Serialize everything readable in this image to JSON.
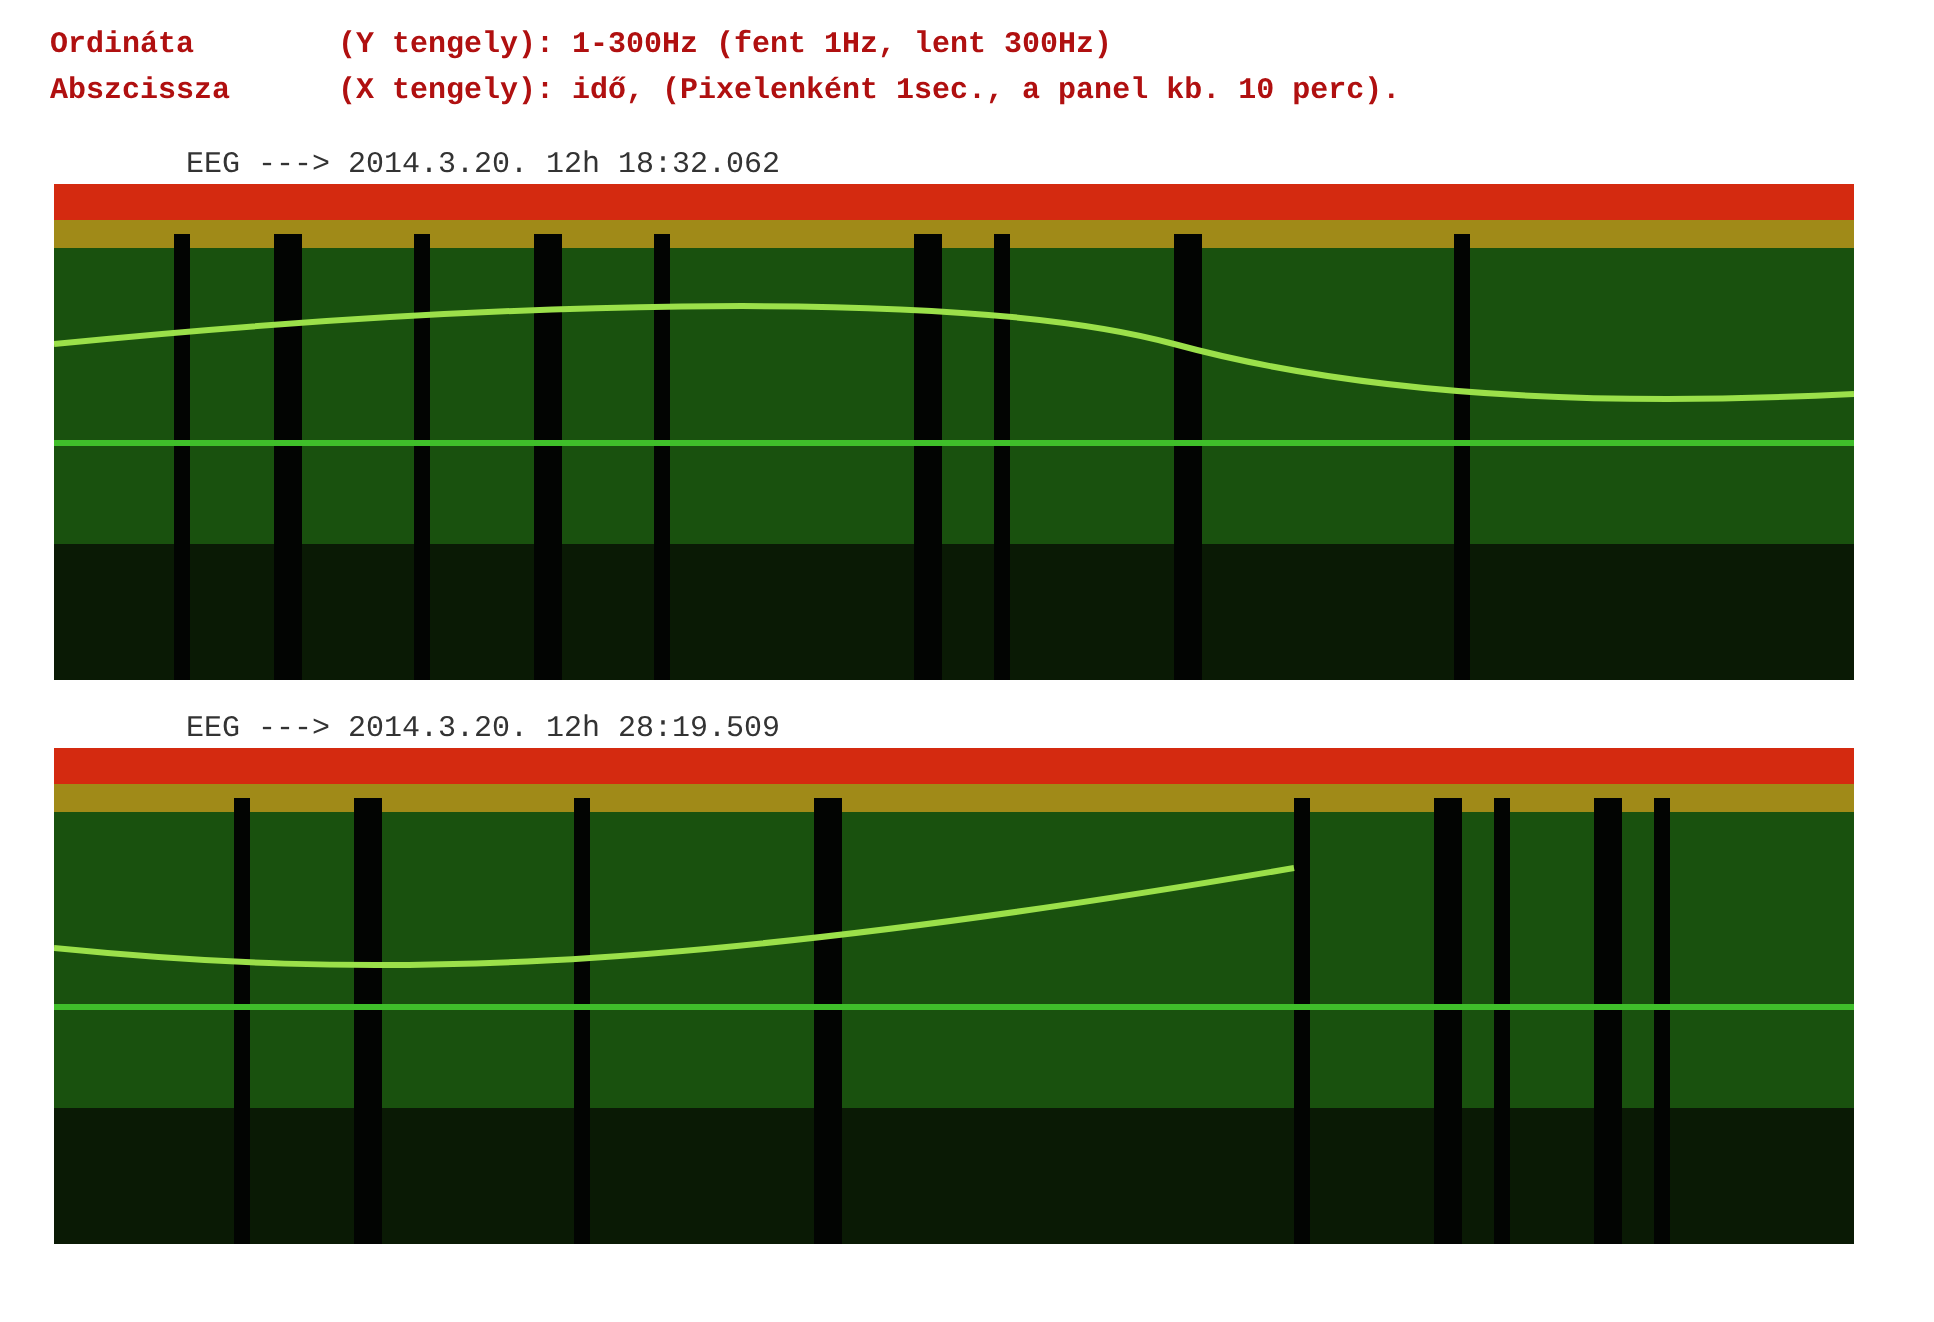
{
  "legend": [
    {
      "label": "Ordináta",
      "text": "(Y tengely): 1-300Hz (fent 1Hz, lent 300Hz)"
    },
    {
      "label": "Abszcissza",
      "text": "(X tengely): idő, (Pixelenként 1sec., a panel kb. 10 perc)."
    }
  ],
  "panels": [
    {
      "caption": "EEG ---> 2014.3.20. 12h 18:32.062",
      "kind": "picture"
    },
    {
      "caption": "EEG ---> 2014.3.20. 12h 28:19.509",
      "kind": "picture"
    }
  ]
}
